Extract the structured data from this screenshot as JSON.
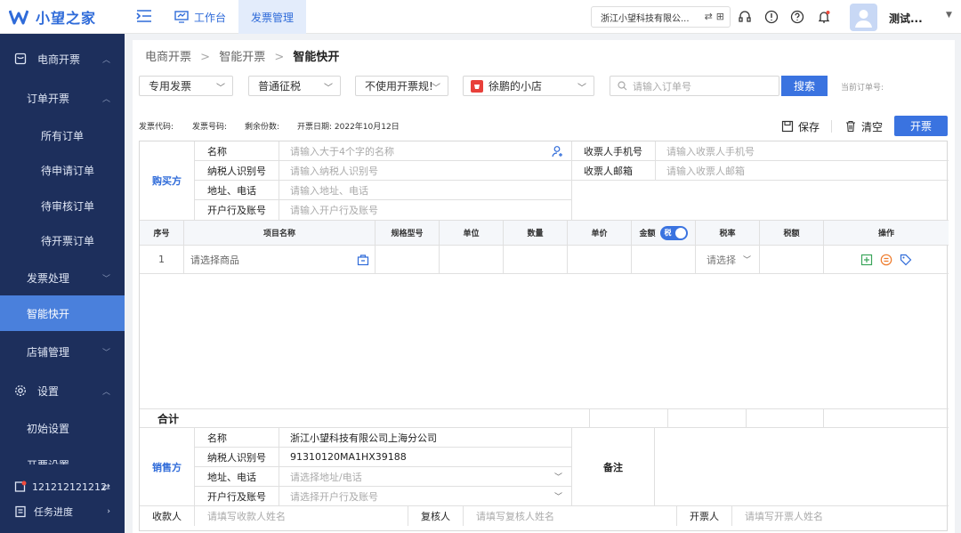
{
  "app": {
    "logo_text": "小望之家",
    "brand_color": "#2f6bd9"
  },
  "topnav": {
    "workbench": "工作台",
    "invoice_mgmt": "发票管理"
  },
  "company": {
    "name": "浙江小望科技有限公..."
  },
  "user": {
    "name": "测试..."
  },
  "sidebar": {
    "items": [
      {
        "label": "电商开票"
      },
      {
        "label": "订单开票"
      },
      {
        "label": "所有订单"
      },
      {
        "label": "待申请订单"
      },
      {
        "label": "待审核订单"
      },
      {
        "label": "待开票订单"
      },
      {
        "label": "发票处理"
      },
      {
        "label": "智能快开"
      },
      {
        "label": "店铺管理"
      },
      {
        "label": "设置"
      },
      {
        "label": "初始设置"
      },
      {
        "label": "开票设置"
      }
    ],
    "account": "121212121212",
    "task": "任务进度"
  },
  "breadcrumb": {
    "a": "电商开票",
    "b": "智能开票",
    "c": "智能快开"
  },
  "filters": {
    "invoice_type": "专用发票",
    "tax_type": "普通征税",
    "rule": "不使用开票规!",
    "shop": "徐鹏的小店",
    "order_placeholder": "请输入订单号",
    "search_label": "搜索",
    "current_order_label": "当前订单号:"
  },
  "meta": {
    "code_label": "发票代码:",
    "number_label": "发票号码:",
    "remaining_label": "剩余份数:",
    "date_label": "开票日期: 2022年10月12日"
  },
  "actions": {
    "save": "保存",
    "clear": "清空",
    "issue": "开票"
  },
  "buyer": {
    "section": "购买方",
    "name_label": "名称",
    "name_ph": "请输入大于4个字的名称",
    "tax_label": "纳税人识别号",
    "tax_ph": "请输入纳税人识别号",
    "addr_label": "地址、电话",
    "addr_ph": "请输入地址、电话",
    "bank_label": "开户行及账号",
    "bank_ph": "请输入开户行及账号",
    "phone_label": "收票人手机号",
    "phone_ph": "请输入收票人手机号",
    "email_label": "收票人邮箱",
    "email_ph": "请输入收票人邮箱"
  },
  "items": {
    "headers": {
      "no": "序号",
      "name": "项目名称",
      "spec": "规格型号",
      "unit": "单位",
      "qty": "数量",
      "price": "单价",
      "amount": "金额",
      "tax_toggle": "税",
      "rate": "税率",
      "tax": "税额",
      "ops": "操作"
    },
    "row": {
      "no": "1",
      "name_ph": "请选择商品",
      "rate_ph": "请选择"
    },
    "total_label": "合计"
  },
  "seller": {
    "section": "销售方",
    "name_label": "名称",
    "name": "浙江小望科技有限公司上海分公司",
    "tax_label": "纳税人识别号",
    "tax": "91310120MA1HX39188",
    "addr_label": "地址、电话",
    "addr_ph": "请选择地址/电话",
    "bank_label": "开户行及账号",
    "bank_ph": "请选择开户行及账号",
    "remark_label": "备注"
  },
  "footer": {
    "payee_label": "收款人",
    "payee_ph": "请填写收款人姓名",
    "reviewer_label": "复核人",
    "reviewer_ph": "请填写复核人姓名",
    "drawer_label": "开票人",
    "drawer_ph": "请填写开票人姓名"
  }
}
